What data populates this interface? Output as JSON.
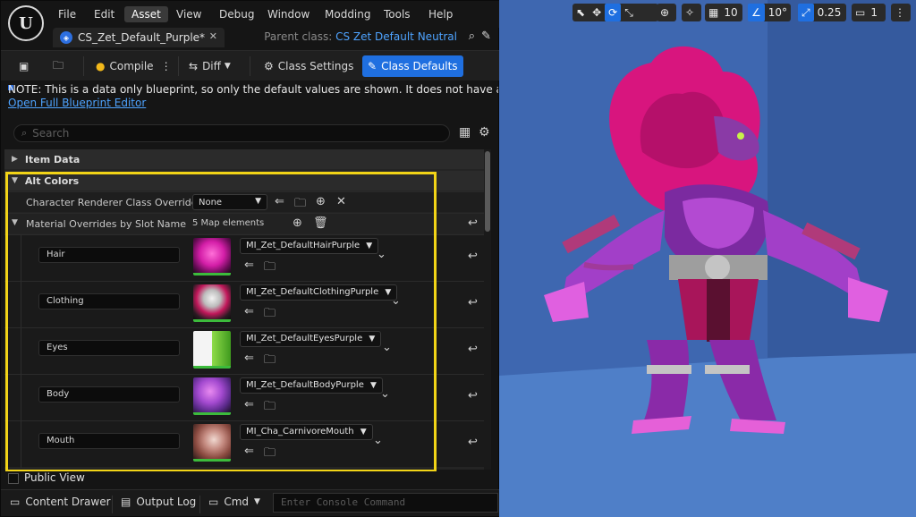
{
  "app": {
    "logo_text": "U",
    "menu": [
      "File",
      "Edit",
      "Asset",
      "View",
      "Debug",
      "Window",
      "Modding",
      "Tools",
      "Help"
    ],
    "active_menu": "Asset",
    "tab_title": "CS_Zet_Default_Purple*",
    "parent_class_label": "Parent class:",
    "parent_class_value": "CS Zet Default Neutral"
  },
  "toolbar": {
    "compile_label": "Compile",
    "diff_label": "Diff",
    "class_settings_label": "Class Settings",
    "class_defaults_label": "Class Defaults"
  },
  "note": {
    "text": "NOTE: This is a data only blueprint, so only the default values are shown.  It does not have any script or",
    "link": "Open Full Blueprint Editor"
  },
  "search": {
    "placeholder": "Search"
  },
  "details": {
    "item_data_label": "Item Data",
    "alt_colors_label": "Alt Colors",
    "renderer_override_label": "Character Renderer Class Override",
    "renderer_override_value": "None",
    "material_overrides_label": "Material Overrides by Slot Name",
    "map_elements_text": "5 Map elements",
    "slots": [
      {
        "key": "Hair",
        "material": "MI_Zet_DefaultHairPurple"
      },
      {
        "key": "Clothing",
        "material": "MI_Zet_DefaultClothingPurple"
      },
      {
        "key": "Eyes",
        "material": "MI_Zet_DefaultEyesPurple"
      },
      {
        "key": "Body",
        "material": "MI_Zet_DefaultBodyPurple"
      },
      {
        "key": "Mouth",
        "material": "MI_Cha_CarnivoreMouth"
      }
    ],
    "public_view_label": "Public View"
  },
  "bottom": {
    "content_drawer_label": "Content Drawer",
    "output_log_label": "Output Log",
    "cmd_label": "Cmd",
    "console_placeholder": "Enter Console Command"
  },
  "viewport": {
    "grid_snap_value": "10",
    "rotation_snap_value": "10°",
    "scale_snap_value": "0.25",
    "camera_speed_value": "1"
  }
}
